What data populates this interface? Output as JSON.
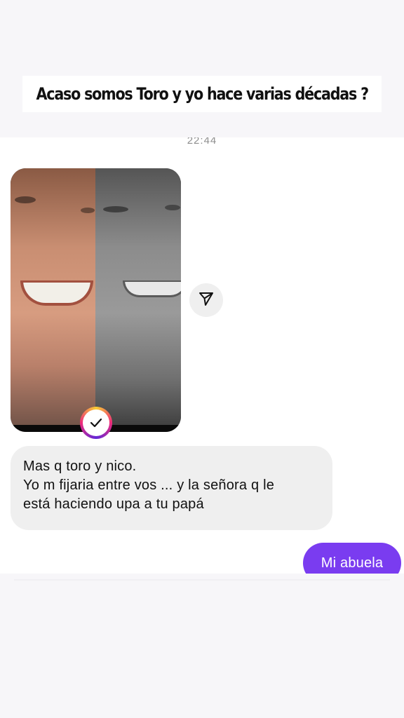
{
  "story": {
    "caption": "Acaso somos Toro y yo hace varias décadas ?"
  },
  "chat": {
    "timestamp": "22:44",
    "photo_message": {
      "icon": "photo",
      "seen_icon": "check-icon"
    },
    "share_icon": "send-icon",
    "received_message": {
      "lines": [
        "Mas q toro y nico.",
        "Yo m fijaria entre vos ... y la señora q le",
        "está haciendo upa a tu papá"
      ]
    },
    "sent_message": {
      "text": "Mi abuela"
    }
  },
  "colors": {
    "sent_bubble": "#7a3cf0",
    "received_bubble": "#efefef",
    "background": "#f7f6f9"
  }
}
